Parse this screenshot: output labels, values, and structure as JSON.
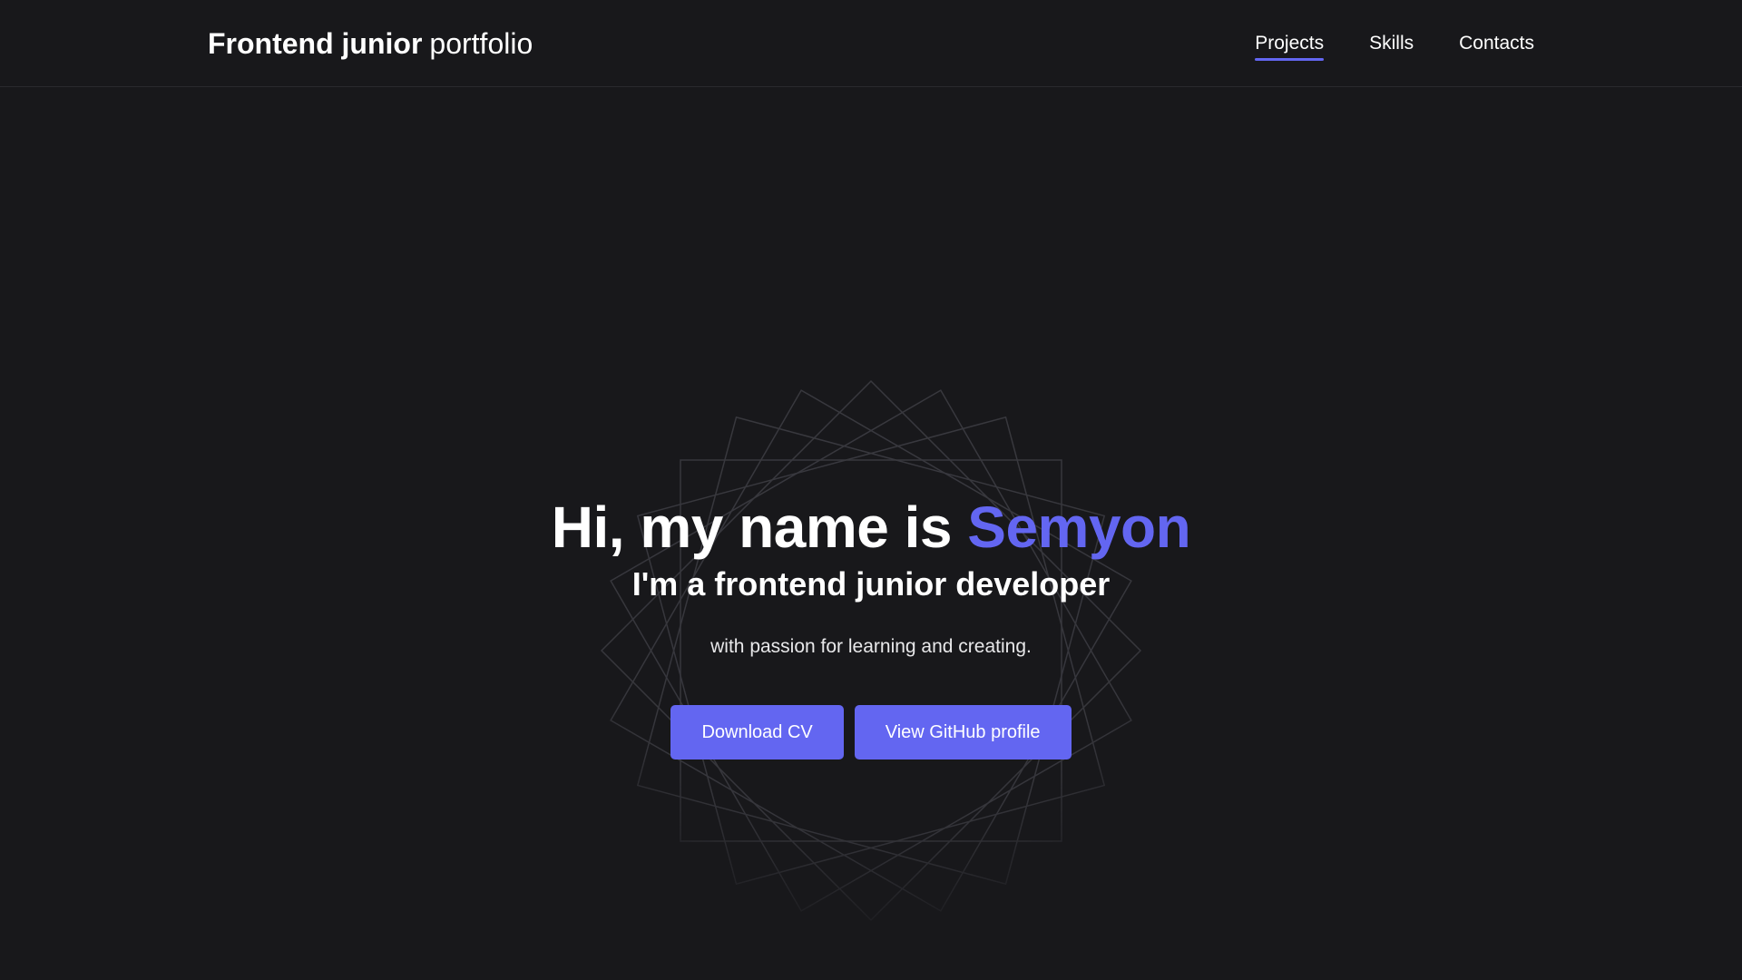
{
  "header": {
    "logo_bold": "Frontend junior",
    "logo_light": "portfolio",
    "nav": [
      {
        "label": "Projects",
        "active": true
      },
      {
        "label": "Skills",
        "active": false
      },
      {
        "label": "Contacts",
        "active": false
      }
    ]
  },
  "hero": {
    "headline_prefix": "Hi, my name is",
    "headline_name": "Semyon",
    "subheadline": "I'm a frontend junior developer",
    "tagline": "with passion for learning and creating.",
    "buttons": {
      "download_cv": "Download CV",
      "github": "View GitHub profile"
    },
    "decoration_icon": "rotated-squares-pattern"
  },
  "colors": {
    "background": "#18181b",
    "accent": "#6366f1",
    "text": "#ffffff"
  }
}
